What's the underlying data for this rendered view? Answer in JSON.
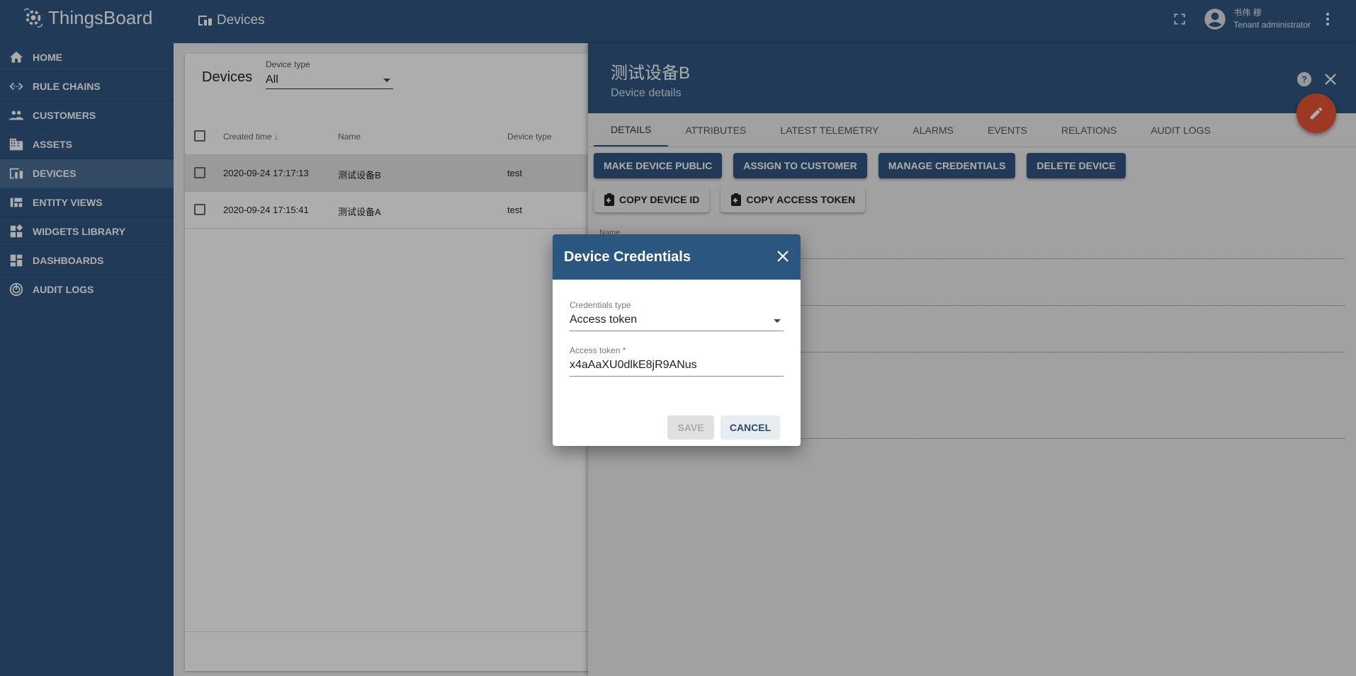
{
  "app": {
    "name": "ThingsBoard",
    "page_title": "Devices"
  },
  "user": {
    "name": "书伟 穆",
    "role": "Tenant administrator"
  },
  "sidebar": {
    "items": [
      {
        "label": "HOME",
        "icon": "home-icon"
      },
      {
        "label": "RULE CHAINS",
        "icon": "code-icon"
      },
      {
        "label": "CUSTOMERS",
        "icon": "people-icon"
      },
      {
        "label": "ASSETS",
        "icon": "building-icon"
      },
      {
        "label": "DEVICES",
        "icon": "devices-icon",
        "active": true
      },
      {
        "label": "ENTITY VIEWS",
        "icon": "view-icon"
      },
      {
        "label": "WIDGETS LIBRARY",
        "icon": "widgets-icon"
      },
      {
        "label": "DASHBOARDS",
        "icon": "dashboard-icon"
      },
      {
        "label": "AUDIT LOGS",
        "icon": "track-changes-icon"
      }
    ]
  },
  "devices": {
    "title": "Devices",
    "filter_label": "Device type",
    "filter_value": "All",
    "columns": [
      "Created time",
      "Name",
      "Device type"
    ],
    "rows": [
      {
        "created": "2020-09-24 17:17:13",
        "name": "测试设备B",
        "type": "test"
      },
      {
        "created": "2020-09-24 17:15:41",
        "name": "测试设备A",
        "type": "test"
      }
    ]
  },
  "details": {
    "title": "测试设备B",
    "subtitle": "Device details",
    "tabs": [
      "DETAILS",
      "ATTRIBUTES",
      "LATEST TELEMETRY",
      "ALARMS",
      "EVENTS",
      "RELATIONS",
      "AUDIT LOGS"
    ],
    "buttons": [
      "MAKE DEVICE PUBLIC",
      "ASSIGN TO CUSTOMER",
      "MANAGE CREDENTIALS",
      "DELETE DEVICE"
    ],
    "copy_buttons": [
      "COPY DEVICE ID",
      "COPY ACCESS TOKEN"
    ],
    "name_label": "Name"
  },
  "dialog": {
    "title": "Device Credentials",
    "cred_type_label": "Credentials type",
    "cred_type_value": "Access token",
    "token_label": "Access token *",
    "token_value": "x4aAaXU0dlkE8jR9ANus",
    "save": "SAVE",
    "cancel": "CANCEL"
  },
  "colors": {
    "primary": "#305680",
    "fab": "#e75534"
  }
}
